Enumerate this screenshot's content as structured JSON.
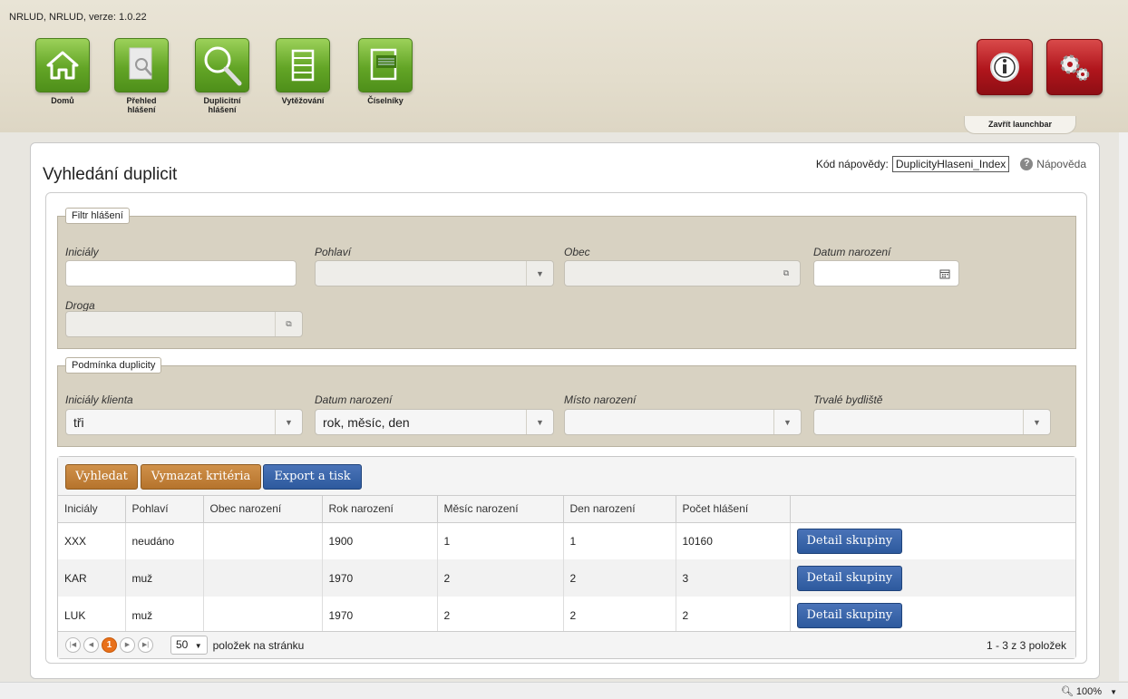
{
  "app_title": "NRLUD, NRLUD, verze: 1.0.22",
  "launchbar": {
    "items": [
      {
        "label": "Domů",
        "icon": "home-icon"
      },
      {
        "label": "Přehled hlášení",
        "icon": "document-search-icon"
      },
      {
        "label": "Duplicitní hlášení",
        "icon": "magnifier-icon"
      },
      {
        "label": "Vytěžování",
        "icon": "list-icon"
      },
      {
        "label": "Číselníky",
        "icon": "codebook-icon"
      }
    ],
    "close_label": "Zavřít launchbar",
    "right_icons": [
      "info-icon",
      "settings-gears-icon"
    ]
  },
  "page": {
    "title": "Vyhledání duplicit",
    "help_code_label": "Kód nápovědy:",
    "help_code_value": "DuplicityHlaseni_Index",
    "help_link": "Nápověda"
  },
  "filter": {
    "legend": "Filtr hlášení",
    "inicialy_label": "Iniciály",
    "inicialy_value": "",
    "pohlavi_label": "Pohlaví",
    "pohlavi_value": "",
    "obec_label": "Obec",
    "obec_value": "",
    "datum_label": "Datum narození",
    "datum_value": "",
    "droga_label": "Droga",
    "droga_value": ""
  },
  "condition": {
    "legend": "Podmínka duplicity",
    "inicialy_label": "Iniciály klienta",
    "inicialy_value": "tři",
    "datum_label": "Datum narození",
    "datum_value": "rok, měsíc, den",
    "misto_label": "Místo narození",
    "misto_value": "",
    "bydliste_label": "Trvalé bydliště",
    "bydliste_value": ""
  },
  "toolbar": {
    "search": "Vyhledat",
    "clear": "Vymazat kritéria",
    "export": "Export a tisk"
  },
  "table": {
    "headers": [
      "Iniciály",
      "Pohlaví",
      "Obec narození",
      "Rok narození",
      "Měsíc narození",
      "Den narození",
      "Počet hlášení",
      ""
    ],
    "rows": [
      [
        "XXX",
        "neudáno",
        "",
        "1900",
        "1",
        "1",
        "10160"
      ],
      [
        "KAR",
        "muž",
        "",
        "1970",
        "2",
        "2",
        "3"
      ],
      [
        "LUK",
        "muž",
        "",
        "1970",
        "2",
        "2",
        "2"
      ]
    ],
    "detail_button": "Detail skupiny"
  },
  "pager": {
    "current_page": "1",
    "page_size": "50",
    "page_size_label": "položek na stránku",
    "summary": "1 - 3 z 3 položek"
  },
  "zoom": "100%",
  "colors": {
    "tile_green": "#63a526",
    "tile_red": "#b0151c",
    "button_orange": "#b5732c",
    "button_blue": "#2d5a9e",
    "fieldset_bg": "#d8d2c2"
  }
}
